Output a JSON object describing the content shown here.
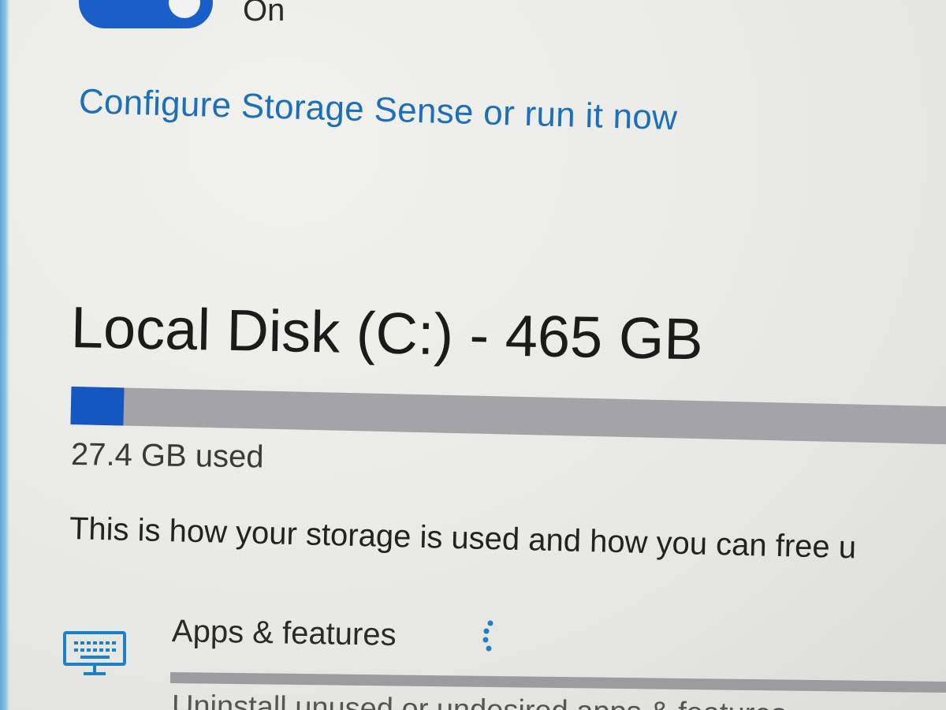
{
  "storage_sense": {
    "toggle_state": "On",
    "configure_link": "Configure Storage Sense or run it now"
  },
  "disk": {
    "title": "Local Disk (C:) - 465 GB",
    "used_label": "27.4 GB used",
    "used_fraction": 0.0589,
    "bar_used_color": "#1557c0",
    "bar_track_color": "#a4a3a8"
  },
  "description": "This is how your storage is used and how you can free u",
  "categories": [
    {
      "label": "Apps & features",
      "icon": "keyboard-monitor-icon",
      "status": "loading-spinner",
      "subtitle": "Uninstall unused or undesired apps & features"
    }
  ],
  "colors": {
    "accent": "#1d6fb8",
    "toggle_on": "#1a5fc8"
  }
}
